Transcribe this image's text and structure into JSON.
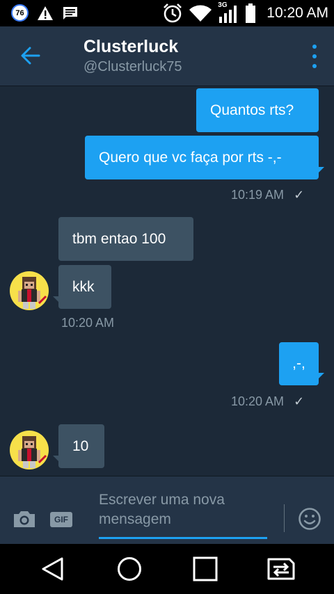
{
  "status_bar": {
    "notification_count": "76",
    "network_type": "3G",
    "time": "10:20 AM",
    "icons": [
      "app-badge-icon",
      "warning-icon",
      "message-icon",
      "alarm-icon",
      "wifi-icon",
      "signal-icon",
      "battery-icon"
    ]
  },
  "header": {
    "title": "Clusterluck",
    "handle": "@Clusterluck75",
    "accent_color": "#1da1f2"
  },
  "messages": [
    {
      "direction": "out",
      "text": "Quantos rts?"
    },
    {
      "direction": "out",
      "text": "Quero que vc faça por rts -,-",
      "time": "10:19 AM",
      "receipt": "✓"
    },
    {
      "direction": "in",
      "text": "tbm entao 100"
    },
    {
      "direction": "in",
      "text": "kkk",
      "time": "10:20 AM"
    },
    {
      "direction": "out",
      "text": ",-,",
      "time": "10:20 AM",
      "receipt": "✓"
    },
    {
      "direction": "in",
      "text": "10"
    }
  ],
  "composer": {
    "placeholder": "Escrever uma nova mensagem",
    "gif_label": "GIF"
  },
  "colors": {
    "header_bg": "#243447",
    "conversation_bg": "#1c2938",
    "outgoing_bubble": "#1da1f2",
    "incoming_bubble": "#3d5263",
    "muted_text": "#8899a6"
  }
}
